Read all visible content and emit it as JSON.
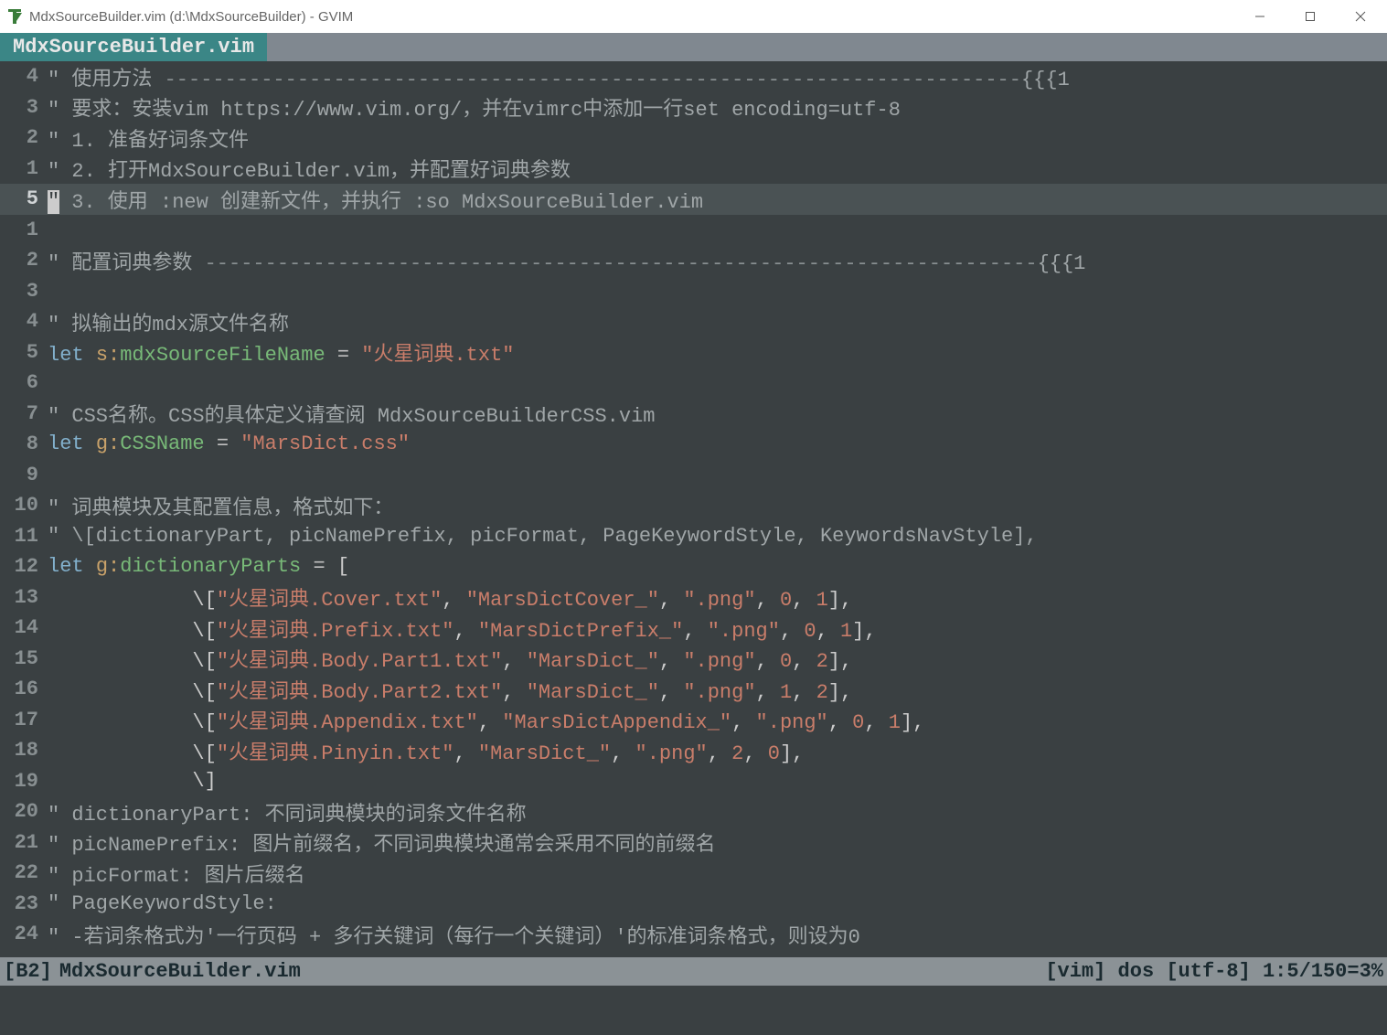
{
  "window": {
    "title": "MdxSourceBuilder.vim (d:\\MdxSourceBuilder) - GVIM"
  },
  "tabs": {
    "active": "MdxSourceBuilder.vim"
  },
  "editor": {
    "relnum": [
      "4",
      "3",
      "2",
      "1",
      "5",
      "1",
      "2",
      "3",
      "4",
      "5",
      "6",
      "7",
      "8",
      "9",
      "10",
      "11",
      "12",
      "13",
      "14",
      "15",
      "16",
      "17",
      "18",
      "19",
      "20",
      "21",
      "22",
      "23",
      "24"
    ],
    "current_index": 4,
    "lines": [
      {
        "tokens": [
          {
            "c": "c-comment",
            "t": "\" 使用方法 "
          },
          {
            "c": "c-dim",
            "t": "-----------------------------------------------------------------------"
          },
          {
            "c": "c-fold",
            "t": "{{{1"
          }
        ]
      },
      {
        "tokens": [
          {
            "c": "c-comment",
            "t": "\" 要求：安装vim https://www.vim.org/，并在vimrc中添加一行set encoding=utf-8"
          }
        ]
      },
      {
        "tokens": [
          {
            "c": "c-comment",
            "t": "\" 1. 准备好词条文件"
          }
        ]
      },
      {
        "tokens": [
          {
            "c": "c-comment",
            "t": "\" 2. 打开MdxSourceBuilder.vim，并配置好词典参数"
          }
        ]
      },
      {
        "tokens": [
          {
            "c": "c-comment",
            "t": " 3. 使用 :new 创建新文件，并执行 :so MdxSourceBuilder.vim"
          }
        ],
        "cursor_before": true
      },
      {
        "tokens": []
      },
      {
        "tokens": [
          {
            "c": "c-comment",
            "t": "\" 配置词典参数 "
          },
          {
            "c": "c-dim",
            "t": "---------------------------------------------------------------------"
          },
          {
            "c": "c-fold",
            "t": "{{{1"
          }
        ]
      },
      {
        "tokens": []
      },
      {
        "tokens": [
          {
            "c": "c-comment",
            "t": "\" 拟输出的mdx源文件名称"
          }
        ]
      },
      {
        "tokens": [
          {
            "c": "c-keyword",
            "t": "let"
          },
          {
            "c": "",
            "t": " "
          },
          {
            "c": "c-ident",
            "t": "s:"
          },
          {
            "c": "c-var",
            "t": "mdxSourceFileName"
          },
          {
            "c": "",
            "t": " "
          },
          {
            "c": "c-op",
            "t": "="
          },
          {
            "c": "",
            "t": " "
          },
          {
            "c": "c-string",
            "t": "\"火星词典.txt\""
          }
        ]
      },
      {
        "tokens": []
      },
      {
        "tokens": [
          {
            "c": "c-comment",
            "t": "\" CSS名称。CSS的具体定义请查阅 MdxSourceBuilderCSS.vim"
          }
        ]
      },
      {
        "tokens": [
          {
            "c": "c-keyword",
            "t": "let"
          },
          {
            "c": "",
            "t": " "
          },
          {
            "c": "c-ident",
            "t": "g:"
          },
          {
            "c": "c-var",
            "t": "CSSName"
          },
          {
            "c": "",
            "t": " "
          },
          {
            "c": "c-op",
            "t": "="
          },
          {
            "c": "",
            "t": " "
          },
          {
            "c": "c-string",
            "t": "\"MarsDict.css\""
          }
        ]
      },
      {
        "tokens": []
      },
      {
        "tokens": [
          {
            "c": "c-comment",
            "t": "\" 词典模块及其配置信息，格式如下："
          }
        ]
      },
      {
        "tokens": [
          {
            "c": "c-comment",
            "t": "\" \\[dictionaryPart, picNamePrefix, picFormat, PageKeywordStyle, KeywordsNavStyle],"
          }
        ]
      },
      {
        "tokens": [
          {
            "c": "c-keyword",
            "t": "let"
          },
          {
            "c": "",
            "t": " "
          },
          {
            "c": "c-ident",
            "t": "g:"
          },
          {
            "c": "c-var",
            "t": "dictionaryParts"
          },
          {
            "c": "",
            "t": " "
          },
          {
            "c": "c-op",
            "t": "="
          },
          {
            "c": "",
            "t": " ["
          }
        ]
      },
      {
        "tokens": [
          {
            "c": "",
            "t": "            \\["
          },
          {
            "c": "c-string",
            "t": "\"火星词典.Cover.txt\""
          },
          {
            "c": "",
            "t": ", "
          },
          {
            "c": "c-string",
            "t": "\"MarsDictCover_\""
          },
          {
            "c": "",
            "t": ", "
          },
          {
            "c": "c-string",
            "t": "\".png\""
          },
          {
            "c": "",
            "t": ", "
          },
          {
            "c": "c-num",
            "t": "0"
          },
          {
            "c": "",
            "t": ", "
          },
          {
            "c": "c-num",
            "t": "1"
          },
          {
            "c": "",
            "t": "],"
          }
        ]
      },
      {
        "tokens": [
          {
            "c": "",
            "t": "            \\["
          },
          {
            "c": "c-string",
            "t": "\"火星词典.Prefix.txt\""
          },
          {
            "c": "",
            "t": ", "
          },
          {
            "c": "c-string",
            "t": "\"MarsDictPrefix_\""
          },
          {
            "c": "",
            "t": ", "
          },
          {
            "c": "c-string",
            "t": "\".png\""
          },
          {
            "c": "",
            "t": ", "
          },
          {
            "c": "c-num",
            "t": "0"
          },
          {
            "c": "",
            "t": ", "
          },
          {
            "c": "c-num",
            "t": "1"
          },
          {
            "c": "",
            "t": "],"
          }
        ]
      },
      {
        "tokens": [
          {
            "c": "",
            "t": "            \\["
          },
          {
            "c": "c-string",
            "t": "\"火星词典.Body.Part1.txt\""
          },
          {
            "c": "",
            "t": ", "
          },
          {
            "c": "c-string",
            "t": "\"MarsDict_\""
          },
          {
            "c": "",
            "t": ", "
          },
          {
            "c": "c-string",
            "t": "\".png\""
          },
          {
            "c": "",
            "t": ", "
          },
          {
            "c": "c-num",
            "t": "0"
          },
          {
            "c": "",
            "t": ", "
          },
          {
            "c": "c-num",
            "t": "2"
          },
          {
            "c": "",
            "t": "],"
          }
        ]
      },
      {
        "tokens": [
          {
            "c": "",
            "t": "            \\["
          },
          {
            "c": "c-string",
            "t": "\"火星词典.Body.Part2.txt\""
          },
          {
            "c": "",
            "t": ", "
          },
          {
            "c": "c-string",
            "t": "\"MarsDict_\""
          },
          {
            "c": "",
            "t": ", "
          },
          {
            "c": "c-string",
            "t": "\".png\""
          },
          {
            "c": "",
            "t": ", "
          },
          {
            "c": "c-num",
            "t": "1"
          },
          {
            "c": "",
            "t": ", "
          },
          {
            "c": "c-num",
            "t": "2"
          },
          {
            "c": "",
            "t": "],"
          }
        ]
      },
      {
        "tokens": [
          {
            "c": "",
            "t": "            \\["
          },
          {
            "c": "c-string",
            "t": "\"火星词典.Appendix.txt\""
          },
          {
            "c": "",
            "t": ", "
          },
          {
            "c": "c-string",
            "t": "\"MarsDictAppendix_\""
          },
          {
            "c": "",
            "t": ", "
          },
          {
            "c": "c-string",
            "t": "\".png\""
          },
          {
            "c": "",
            "t": ", "
          },
          {
            "c": "c-num",
            "t": "0"
          },
          {
            "c": "",
            "t": ", "
          },
          {
            "c": "c-num",
            "t": "1"
          },
          {
            "c": "",
            "t": "],"
          }
        ]
      },
      {
        "tokens": [
          {
            "c": "",
            "t": "            \\["
          },
          {
            "c": "c-string",
            "t": "\"火星词典.Pinyin.txt\""
          },
          {
            "c": "",
            "t": ", "
          },
          {
            "c": "c-string",
            "t": "\"MarsDict_\""
          },
          {
            "c": "",
            "t": ", "
          },
          {
            "c": "c-string",
            "t": "\".png\""
          },
          {
            "c": "",
            "t": ", "
          },
          {
            "c": "c-num",
            "t": "2"
          },
          {
            "c": "",
            "t": ", "
          },
          {
            "c": "c-num",
            "t": "0"
          },
          {
            "c": "",
            "t": "],"
          }
        ]
      },
      {
        "tokens": [
          {
            "c": "",
            "t": "            \\]"
          }
        ]
      },
      {
        "tokens": [
          {
            "c": "c-comment",
            "t": "\" dictionaryPart: 不同词典模块的词条文件名称"
          }
        ]
      },
      {
        "tokens": [
          {
            "c": "c-comment",
            "t": "\" picNamePrefix: 图片前缀名，不同词典模块通常会采用不同的前缀名"
          }
        ]
      },
      {
        "tokens": [
          {
            "c": "c-comment",
            "t": "\" picFormat: 图片后缀名"
          }
        ]
      },
      {
        "tokens": [
          {
            "c": "c-comment",
            "t": "\" PageKeywordStyle:"
          }
        ]
      },
      {
        "tokens": [
          {
            "c": "c-comment",
            "t": "\" -若词条格式为'一行页码 + 多行关键词（每行一个关键词）'的标准词条格式，则设为0"
          }
        ]
      }
    ]
  },
  "statusline": {
    "buffer": "[B2]",
    "file": "MdxSourceBuilder.vim",
    "right": "[vim] dos [utf-8] 1:5/150=3%"
  }
}
